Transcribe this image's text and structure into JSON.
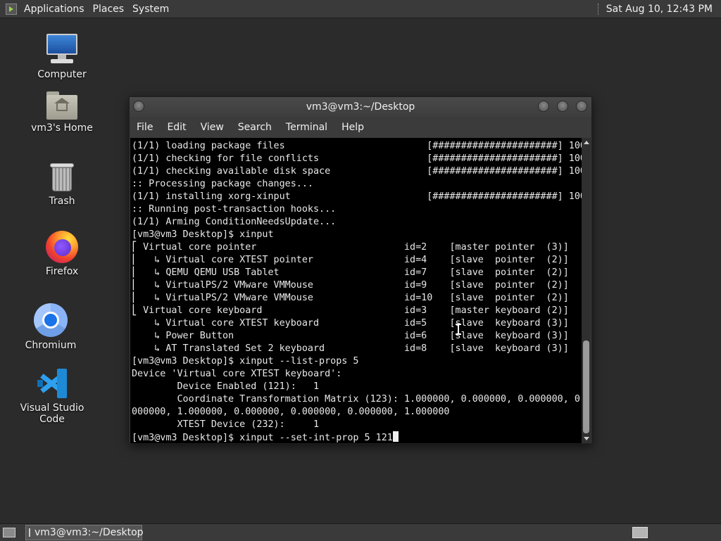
{
  "top_panel": {
    "menus": [
      "Applications",
      "Places",
      "System"
    ],
    "clock": "Sat Aug 10, 12:43 PM"
  },
  "desktop_icons": [
    {
      "label": "Computer",
      "icon": "computer-icon"
    },
    {
      "label": "vm3's Home",
      "icon": "home-folder-icon"
    },
    {
      "label": "Trash",
      "icon": "trash-icon"
    },
    {
      "label": "Firefox",
      "icon": "firefox-icon"
    },
    {
      "label": "Chromium",
      "icon": "chromium-icon"
    },
    {
      "label": "Visual Studio Code",
      "icon": "vscode-icon"
    }
  ],
  "terminal": {
    "title": "vm3@vm3:~/Desktop",
    "menu": [
      "File",
      "Edit",
      "View",
      "Search",
      "Terminal",
      "Help"
    ],
    "lines": [
      "(1/1) loading package files                         [######################] 100%",
      "(1/1) checking for file conflicts                   [######################] 100%",
      "(1/1) checking available disk space                 [######################] 100%",
      ":: Processing package changes...",
      "(1/1) installing xorg-xinput                        [######################] 100%",
      ":: Running post-transaction hooks...",
      "(1/1) Arming ConditionNeedsUpdate...",
      "[vm3@vm3 Desktop]$ xinput",
      "⎡ Virtual core pointer                          id=2    [master pointer  (3)]",
      "⎜   ↳ Virtual core XTEST pointer                id=4    [slave  pointer  (2)]",
      "⎜   ↳ QEMU QEMU USB Tablet                      id=7    [slave  pointer  (2)]",
      "⎜   ↳ VirtualPS/2 VMware VMMouse                id=9    [slave  pointer  (2)]",
      "⎜   ↳ VirtualPS/2 VMware VMMouse                id=10   [slave  pointer  (2)]",
      "⎣ Virtual core keyboard                         id=3    [master keyboard (2)]",
      "    ↳ Virtual core XTEST keyboard               id=5    [slave  keyboard (3)]",
      "    ↳ Power Button                              id=6    [slave  keyboard (3)]",
      "    ↳ AT Translated Set 2 keyboard              id=8    [slave  keyboard (3)]",
      "[vm3@vm3 Desktop]$ xinput --list-props 5",
      "Device 'Virtual core XTEST keyboard':",
      "        Device Enabled (121):   1",
      "        Coordinate Transformation Matrix (123): 1.000000, 0.000000, 0.000000, 0.",
      "000000, 1.000000, 0.000000, 0.000000, 0.000000, 1.000000",
      "        XTEST Device (232):     1"
    ],
    "prompt_line": "[vm3@vm3 Desktop]$ xinput --set-int-prop 5 121"
  },
  "taskbar": {
    "task_label": "vm3@vm3:~/Desktop"
  }
}
